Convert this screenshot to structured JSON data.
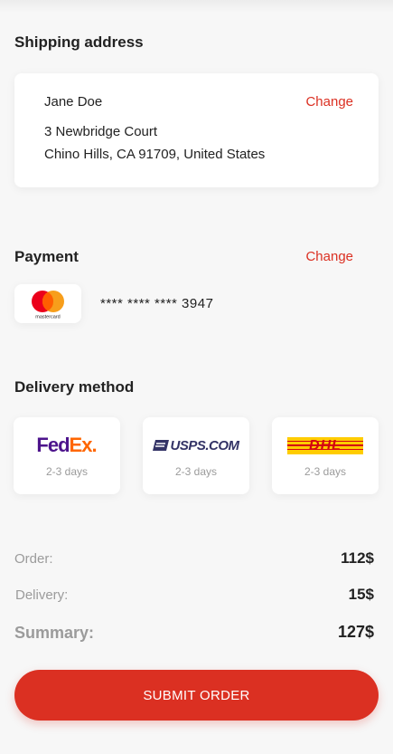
{
  "shipping": {
    "title": "Shipping address",
    "name": "Jane Doe",
    "change_label": "Change",
    "line1": "3 Newbridge Court",
    "line2": "Chino Hills, CA 91709, United States"
  },
  "payment": {
    "title": "Payment",
    "change_label": "Change",
    "card_brand": "mastercard",
    "masked_number": "**** **** **** 3947"
  },
  "delivery": {
    "title": "Delivery method",
    "options": [
      {
        "carrier": "FedEx",
        "logo_text_1": "Fed",
        "logo_text_2": "Ex",
        "logo_dot": ".",
        "days": "2-3 days"
      },
      {
        "carrier": "USPS",
        "logo_text": "USPS.COM",
        "days": "2-3 days"
      },
      {
        "carrier": "DHL",
        "logo_text": "DHL",
        "days": "2-3 days"
      }
    ]
  },
  "summary": {
    "order_label": "Order:",
    "order_value": "112$",
    "delivery_label": "Delivery:",
    "delivery_value": "15$",
    "summary_label": "Summary:",
    "summary_value": "127$"
  },
  "submit_label": "SUBMIT ORDER",
  "colors": {
    "accent": "#db3022",
    "background": "#f7f7f7",
    "muted": "#9b9b9b",
    "fedex_purple": "#4d148c",
    "fedex_orange": "#ff6600",
    "usps_blue": "#333366",
    "dhl_yellow": "#ffcc00",
    "dhl_red": "#d40511"
  }
}
